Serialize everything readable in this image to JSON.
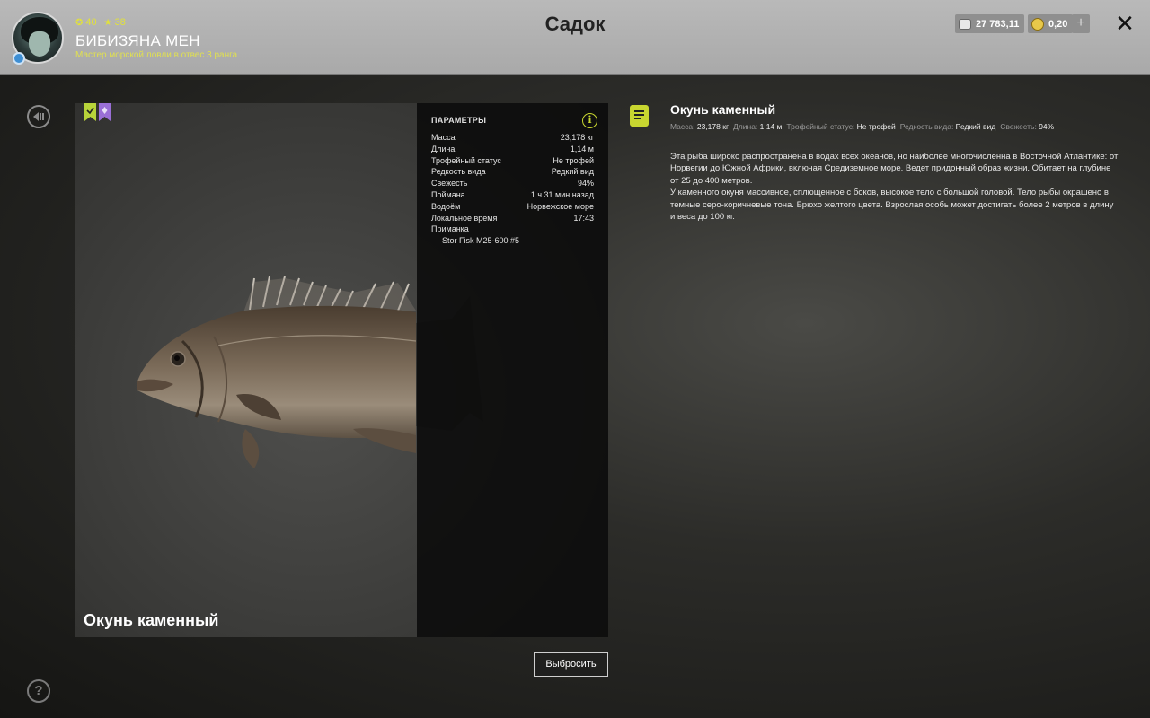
{
  "header": {
    "title": "Садок",
    "player_name": "БИБИЗЯНА МЕН",
    "player_rank": "Мастер морской ловли в отвес 3 ранга",
    "stat_level": "40",
    "stat_stars": "38",
    "silver": "27 783,11",
    "gold": "0,20",
    "plus_label": "+",
    "close_label": "✕"
  },
  "fish": {
    "name": "Окунь каменный",
    "params_title": "ПАРАМЕТРЫ",
    "params": [
      {
        "label": "Масса",
        "value": "23,178 кг"
      },
      {
        "label": "Длина",
        "value": "1,14 м"
      },
      {
        "label": "Трофейный статус",
        "value": "Не трофей"
      },
      {
        "label": "Редкость вида",
        "value": "Редкий вид"
      },
      {
        "label": "Свежесть",
        "value": "94%"
      },
      {
        "label": "Поймана",
        "value": "1 ч 31 мин назад"
      },
      {
        "label": "Водоём",
        "value": "Норвежское море"
      },
      {
        "label": "Локальное время",
        "value": "17:43"
      },
      {
        "label": "Приманка",
        "value": ""
      }
    ],
    "bait": "Stor Fisk M25-600 #5",
    "discard_label": "Выбросить"
  },
  "description": {
    "title": "Окунь каменный",
    "meta": [
      {
        "label": "Масса:",
        "value": "23,178 кг"
      },
      {
        "label": "Длина:",
        "value": "1,14 м"
      },
      {
        "label": "Трофейный статус:",
        "value": "Не трофей"
      },
      {
        "label": "Редкость вида:",
        "value": "Редкий вид"
      },
      {
        "label": "Свежесть:",
        "value": "94%"
      }
    ],
    "paragraphs": [
      "Эта рыба широко распространена в водах всех океанов, но наиболее многочисленна в Восточной Атлантике: от Норвегии до Южной Африки, включая Средиземное море. Ведет придонный образ жизни. Обитает на глубине от 25 до 400 метров.",
      "У каменного окуня массивное, сплющенное с боков, высокое тело с большой головой. Тело рыбы окрашено в темные серо-коричневые тона. Брюхо желтого цвета. Взрослая особь может достигать более 2 метров в длину и веса до 100 кг."
    ]
  },
  "icons": {
    "back": "back-arrow-icon",
    "help": "question-icon",
    "info": "info-icon",
    "doc": "document-icon"
  },
  "colors": {
    "accent_yellow": "#c8d630",
    "bookmark_green": "#b8d43a",
    "bookmark_purple": "#9a6fd6"
  }
}
